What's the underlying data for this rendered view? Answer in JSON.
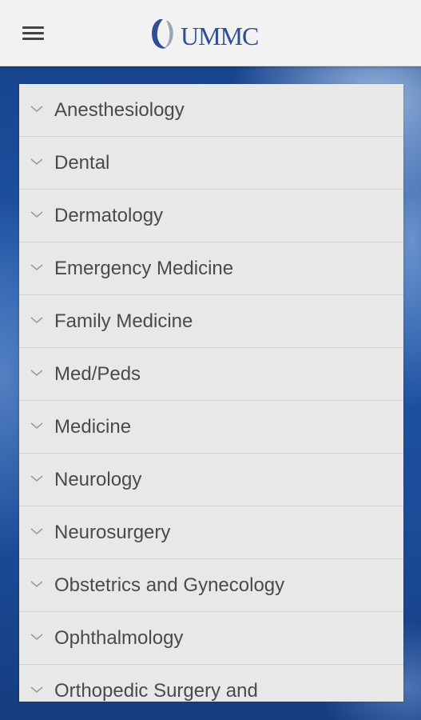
{
  "header": {
    "logo_text": "UMMC",
    "menu_icon": "hamburger-menu-icon"
  },
  "colors": {
    "header_bg": "#f2f2f2",
    "background_blue": "#1e55a6",
    "list_bg": "#e8e8e8",
    "text": "#4a4a4a",
    "logo_blue": "#2e4f93"
  },
  "departments": [
    {
      "label": "Anesthesiology"
    },
    {
      "label": "Dental"
    },
    {
      "label": "Dermatology"
    },
    {
      "label": "Emergency Medicine"
    },
    {
      "label": "Family Medicine"
    },
    {
      "label": "Med/Peds"
    },
    {
      "label": "Medicine"
    },
    {
      "label": "Neurology"
    },
    {
      "label": "Neurosurgery"
    },
    {
      "label": "Obstetrics and Gynecology"
    },
    {
      "label": "Ophthalmology"
    },
    {
      "label": "Orthopedic Surgery and"
    }
  ],
  "item_icon": "chevron-down-icon"
}
